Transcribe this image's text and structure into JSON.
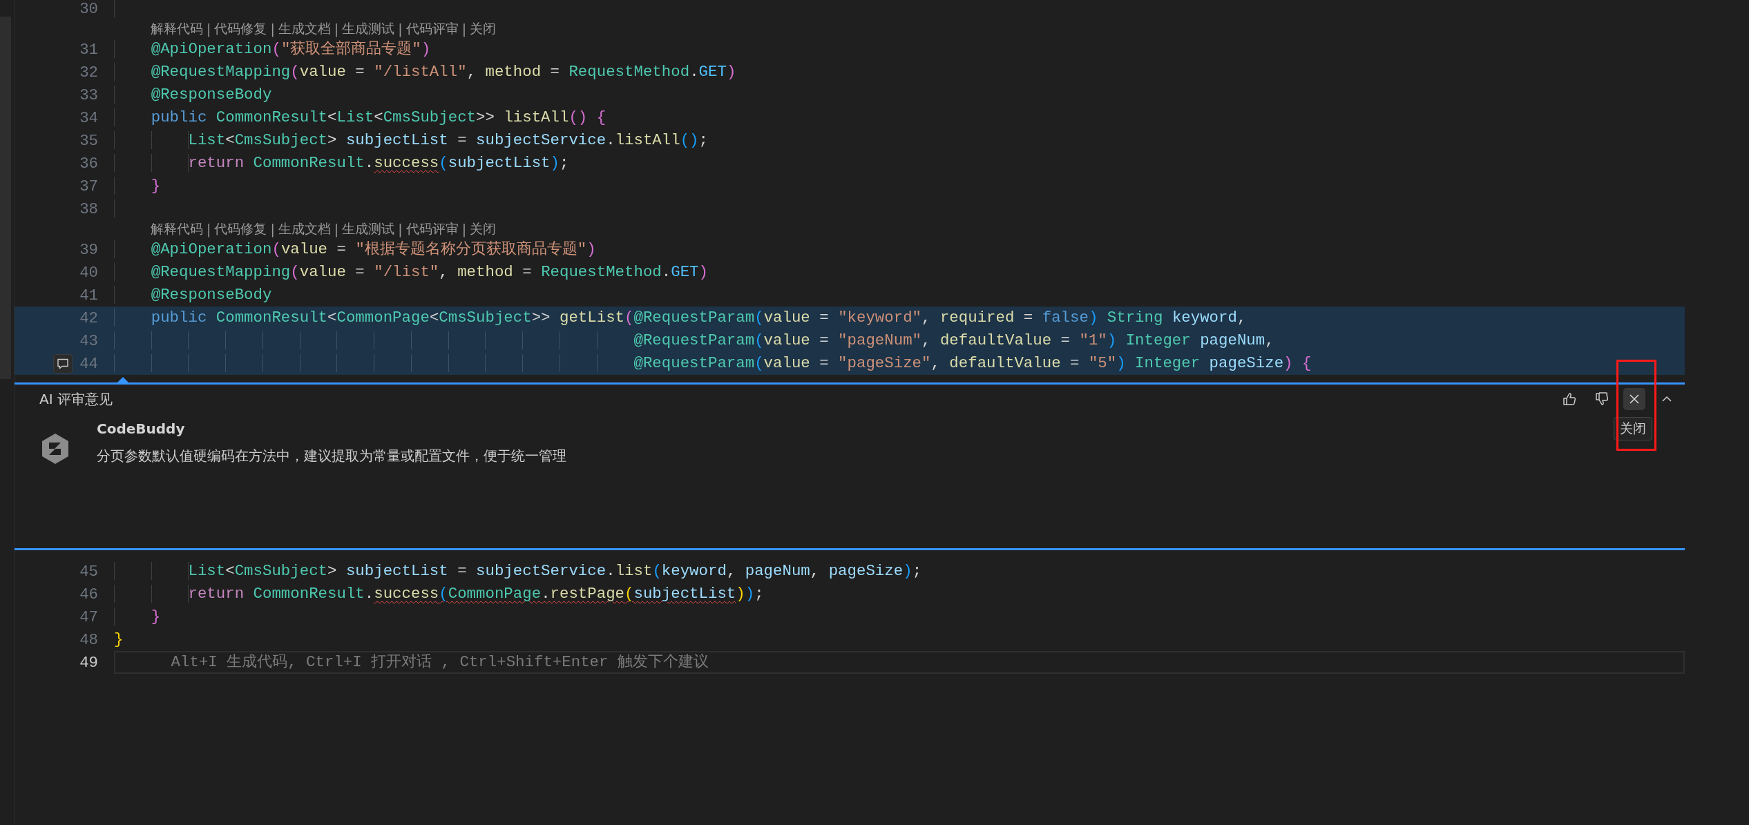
{
  "editor": {
    "rows": [
      {
        "kind": "line",
        "number": "30",
        "lead": "    ",
        "tokens": [],
        "highlighted": false,
        "current": false
      },
      {
        "kind": "codelens",
        "actions": [
          "解释代码",
          "代码修复",
          "生成文档",
          "生成测试",
          "代码评审",
          "关闭"
        ],
        "separator": "|"
      },
      {
        "kind": "line",
        "number": "31",
        "lead": "    ",
        "tokens": [
          {
            "text": "@ApiOperation",
            "kind": "type"
          },
          {
            "text": "(",
            "kind": "b2"
          },
          {
            "text": "\"获取全部商品专题\"",
            "kind": "str"
          },
          {
            "text": ")",
            "kind": "b2"
          }
        ],
        "highlighted": false,
        "current": false
      },
      {
        "kind": "line",
        "number": "32",
        "lead": "    ",
        "tokens": [
          {
            "text": "@RequestMapping",
            "kind": "type"
          },
          {
            "text": "(",
            "kind": "b2"
          },
          {
            "text": "value",
            "kind": "fn"
          },
          {
            "text": " = ",
            "kind": "plain"
          },
          {
            "text": "\"/listAll\"",
            "kind": "str"
          },
          {
            "text": ", ",
            "kind": "plain"
          },
          {
            "text": "method",
            "kind": "fn"
          },
          {
            "text": " = ",
            "kind": "plain"
          },
          {
            "text": "RequestMethod",
            "kind": "type"
          },
          {
            "text": ".",
            "kind": "plain"
          },
          {
            "text": "GET",
            "kind": "const"
          },
          {
            "text": ")",
            "kind": "b2"
          }
        ],
        "highlighted": false,
        "current": false
      },
      {
        "kind": "line",
        "number": "33",
        "lead": "    ",
        "tokens": [
          {
            "text": "@ResponseBody",
            "kind": "type"
          }
        ],
        "highlighted": false,
        "current": false
      },
      {
        "kind": "line",
        "number": "34",
        "lead": "    ",
        "tokens": [
          {
            "text": "public ",
            "kind": "kw"
          },
          {
            "text": "CommonResult",
            "kind": "type"
          },
          {
            "text": "<",
            "kind": "plain"
          },
          {
            "text": "List",
            "kind": "type"
          },
          {
            "text": "<",
            "kind": "plain"
          },
          {
            "text": "CmsSubject",
            "kind": "type"
          },
          {
            "text": ">> ",
            "kind": "plain"
          },
          {
            "text": "listAll",
            "kind": "fn"
          },
          {
            "text": "() ",
            "kind": "b2"
          },
          {
            "text": "{",
            "kind": "b2"
          }
        ],
        "highlighted": false,
        "current": false
      },
      {
        "kind": "line",
        "number": "35",
        "lead": "        ",
        "tokens": [
          {
            "text": "List",
            "kind": "type"
          },
          {
            "text": "<",
            "kind": "plain"
          },
          {
            "text": "CmsSubject",
            "kind": "type"
          },
          {
            "text": "> ",
            "kind": "plain"
          },
          {
            "text": "subjectList",
            "kind": "var"
          },
          {
            "text": " = ",
            "kind": "plain"
          },
          {
            "text": "subjectService",
            "kind": "var"
          },
          {
            "text": ".",
            "kind": "plain"
          },
          {
            "text": "listAll",
            "kind": "fn"
          },
          {
            "text": "()",
            "kind": "b3"
          },
          {
            "text": ";",
            "kind": "plain"
          }
        ],
        "highlighted": false,
        "current": false
      },
      {
        "kind": "line",
        "number": "36",
        "lead": "        ",
        "tokens": [
          {
            "text": "return ",
            "kind": "ctl"
          },
          {
            "text": "CommonResult",
            "kind": "type"
          },
          {
            "text": ".",
            "kind": "plain"
          },
          {
            "text": "success",
            "kind": "fn",
            "squiggle": true
          },
          {
            "text": "(",
            "kind": "b3"
          },
          {
            "text": "subjectList",
            "kind": "var"
          },
          {
            "text": ")",
            "kind": "b3"
          },
          {
            "text": ";",
            "kind": "plain"
          }
        ],
        "highlighted": false,
        "current": false
      },
      {
        "kind": "line",
        "number": "37",
        "lead": "    ",
        "tokens": [
          {
            "text": "}",
            "kind": "b2"
          }
        ],
        "highlighted": false,
        "current": false
      },
      {
        "kind": "line",
        "number": "38",
        "lead": "    ",
        "tokens": [],
        "highlighted": false,
        "current": false
      },
      {
        "kind": "codelens",
        "actions": [
          "解释代码",
          "代码修复",
          "生成文档",
          "生成测试",
          "代码评审",
          "关闭"
        ],
        "separator": "|"
      },
      {
        "kind": "line",
        "number": "39",
        "lead": "    ",
        "tokens": [
          {
            "text": "@ApiOperation",
            "kind": "type"
          },
          {
            "text": "(",
            "kind": "b2"
          },
          {
            "text": "value",
            "kind": "fn"
          },
          {
            "text": " = ",
            "kind": "plain"
          },
          {
            "text": "\"根据专题名称分页获取商品专题\"",
            "kind": "str"
          },
          {
            "text": ")",
            "kind": "b2"
          }
        ],
        "highlighted": false,
        "current": false
      },
      {
        "kind": "line",
        "number": "40",
        "lead": "    ",
        "tokens": [
          {
            "text": "@RequestMapping",
            "kind": "type"
          },
          {
            "text": "(",
            "kind": "b2"
          },
          {
            "text": "value",
            "kind": "fn"
          },
          {
            "text": " = ",
            "kind": "plain"
          },
          {
            "text": "\"/list\"",
            "kind": "str"
          },
          {
            "text": ", ",
            "kind": "plain"
          },
          {
            "text": "method",
            "kind": "fn"
          },
          {
            "text": " = ",
            "kind": "plain"
          },
          {
            "text": "RequestMethod",
            "kind": "type"
          },
          {
            "text": ".",
            "kind": "plain"
          },
          {
            "text": "GET",
            "kind": "const"
          },
          {
            "text": ")",
            "kind": "b2"
          }
        ],
        "highlighted": false,
        "current": false
      },
      {
        "kind": "line",
        "number": "41",
        "lead": "    ",
        "tokens": [
          {
            "text": "@ResponseBody",
            "kind": "type"
          }
        ],
        "highlighted": false,
        "current": false
      },
      {
        "kind": "line",
        "number": "42",
        "lead": "    ",
        "tokens": [
          {
            "text": "public ",
            "kind": "kw"
          },
          {
            "text": "CommonResult",
            "kind": "type"
          },
          {
            "text": "<",
            "kind": "plain"
          },
          {
            "text": "CommonPage",
            "kind": "type"
          },
          {
            "text": "<",
            "kind": "plain"
          },
          {
            "text": "CmsSubject",
            "kind": "type"
          },
          {
            "text": ">> ",
            "kind": "plain"
          },
          {
            "text": "getList",
            "kind": "fn"
          },
          {
            "text": "(",
            "kind": "b2"
          },
          {
            "text": "@RequestParam",
            "kind": "type"
          },
          {
            "text": "(",
            "kind": "b3"
          },
          {
            "text": "value",
            "kind": "fn"
          },
          {
            "text": " = ",
            "kind": "plain"
          },
          {
            "text": "\"keyword\"",
            "kind": "str"
          },
          {
            "text": ", ",
            "kind": "plain"
          },
          {
            "text": "required",
            "kind": "fn"
          },
          {
            "text": " = ",
            "kind": "plain"
          },
          {
            "text": "false",
            "kind": "kw"
          },
          {
            "text": ") ",
            "kind": "b3"
          },
          {
            "text": "String ",
            "kind": "type"
          },
          {
            "text": "keyword",
            "kind": "var"
          },
          {
            "text": ",",
            "kind": "plain"
          }
        ],
        "highlighted": true,
        "current": false
      },
      {
        "kind": "line",
        "number": "43",
        "lead": "                                                        ",
        "tokens": [
          {
            "text": "@RequestParam",
            "kind": "type"
          },
          {
            "text": "(",
            "kind": "b3"
          },
          {
            "text": "value",
            "kind": "fn"
          },
          {
            "text": " = ",
            "kind": "plain"
          },
          {
            "text": "\"pageNum\"",
            "kind": "str"
          },
          {
            "text": ", ",
            "kind": "plain"
          },
          {
            "text": "defaultValue",
            "kind": "fn"
          },
          {
            "text": " = ",
            "kind": "plain"
          },
          {
            "text": "\"1\"",
            "kind": "str"
          },
          {
            "text": ") ",
            "kind": "b3"
          },
          {
            "text": "Integer ",
            "kind": "type"
          },
          {
            "text": "pageNum",
            "kind": "var"
          },
          {
            "text": ",",
            "kind": "plain"
          }
        ],
        "highlighted": true,
        "current": false
      },
      {
        "kind": "line",
        "number": "44",
        "lead": "                                                        ",
        "tokens": [
          {
            "text": "@RequestParam",
            "kind": "type"
          },
          {
            "text": "(",
            "kind": "b3"
          },
          {
            "text": "value",
            "kind": "fn"
          },
          {
            "text": " = ",
            "kind": "plain"
          },
          {
            "text": "\"pageSize\"",
            "kind": "str"
          },
          {
            "text": ", ",
            "kind": "plain"
          },
          {
            "text": "defaultValue",
            "kind": "fn"
          },
          {
            "text": " = ",
            "kind": "plain"
          },
          {
            "text": "\"5\"",
            "kind": "str"
          },
          {
            "text": ") ",
            "kind": "b3"
          },
          {
            "text": "Integer ",
            "kind": "type"
          },
          {
            "text": "pageSize",
            "kind": "var"
          },
          {
            "text": ") ",
            "kind": "b2"
          },
          {
            "text": "{",
            "kind": "b2"
          }
        ],
        "highlighted": true,
        "current": false,
        "comment_button": true
      },
      {
        "kind": "review",
        "title": "AI 评审意见",
        "author": "CodeBuddy",
        "message": "分页参数默认值硬编码在方法中，建议提取为常量或配置文件，便于统一管理",
        "tooltip": "关闭"
      },
      {
        "kind": "line",
        "number": "45",
        "lead": "        ",
        "tokens": [
          {
            "text": "List",
            "kind": "type"
          },
          {
            "text": "<",
            "kind": "plain"
          },
          {
            "text": "CmsSubject",
            "kind": "type"
          },
          {
            "text": "> ",
            "kind": "plain"
          },
          {
            "text": "subjectList",
            "kind": "var"
          },
          {
            "text": " = ",
            "kind": "plain"
          },
          {
            "text": "subjectService",
            "kind": "var"
          },
          {
            "text": ".",
            "kind": "plain"
          },
          {
            "text": "list",
            "kind": "fn"
          },
          {
            "text": "(",
            "kind": "b3"
          },
          {
            "text": "keyword",
            "kind": "var"
          },
          {
            "text": ", ",
            "kind": "plain"
          },
          {
            "text": "pageNum",
            "kind": "var"
          },
          {
            "text": ", ",
            "kind": "plain"
          },
          {
            "text": "pageSize",
            "kind": "var"
          },
          {
            "text": ")",
            "kind": "b3"
          },
          {
            "text": ";",
            "kind": "plain"
          }
        ],
        "highlighted": false,
        "current": false
      },
      {
        "kind": "line",
        "number": "46",
        "lead": "        ",
        "tokens": [
          {
            "text": "return ",
            "kind": "ctl"
          },
          {
            "text": "CommonResult",
            "kind": "type"
          },
          {
            "text": ".",
            "kind": "plain"
          },
          {
            "text": "success",
            "kind": "fn",
            "squiggle": true
          },
          {
            "text": "(",
            "kind": "b3",
            "squiggle": true
          },
          {
            "text": "CommonPage",
            "kind": "type",
            "squiggle": true
          },
          {
            "text": ".",
            "kind": "plain",
            "squiggle": true
          },
          {
            "text": "restPage",
            "kind": "fn",
            "squiggle": true
          },
          {
            "text": "(",
            "kind": "b1",
            "squiggle": true
          },
          {
            "text": "subjectList",
            "kind": "var",
            "squiggle": true
          },
          {
            "text": ")",
            "kind": "b1"
          },
          {
            "text": ")",
            "kind": "b3"
          },
          {
            "text": ";",
            "kind": "plain"
          }
        ],
        "highlighted": false,
        "current": false
      },
      {
        "kind": "line",
        "number": "47",
        "lead": "    ",
        "tokens": [
          {
            "text": "}",
            "kind": "b2"
          }
        ],
        "highlighted": false,
        "current": false
      },
      {
        "kind": "line",
        "number": "48",
        "tokens": [
          {
            "text": "}",
            "kind": "b1"
          }
        ],
        "highlighted": false,
        "current": false
      },
      {
        "kind": "line",
        "number": "49",
        "tokens": [],
        "ghost": "Alt+I 生成代码, Ctrl+I 打开对话 , Ctrl+Shift+Enter 触发下个建议",
        "highlighted": false,
        "current": true
      }
    ]
  }
}
